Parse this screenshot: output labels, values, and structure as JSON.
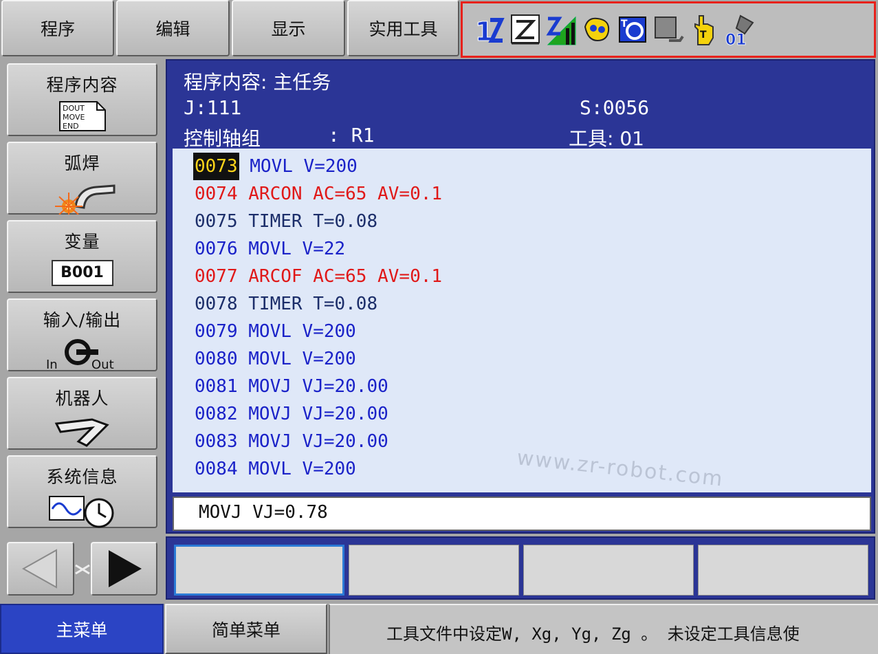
{
  "top_menu": [
    {
      "label": "程序"
    },
    {
      "label": "编辑"
    },
    {
      "label": "显示"
    },
    {
      "label": "实用工具"
    }
  ],
  "status_icons": {
    "tool_number": "01",
    "alert_color": "#e8211b"
  },
  "sidebar": {
    "items": [
      {
        "label": "程序内容",
        "icon_text": [
          "DOUT",
          "MOVE",
          "END"
        ]
      },
      {
        "label": "弧焊"
      },
      {
        "label": "变量",
        "icon_text": "B001"
      },
      {
        "label": "输入/输出",
        "icon_in": "In",
        "icon_out": "Out"
      },
      {
        "label": "机器人"
      },
      {
        "label": "系统信息"
      }
    ]
  },
  "header": {
    "title": "程序内容: 主任务",
    "job": "J:111",
    "step": "S:0056",
    "axis_group_label": "控制轴组",
    "axis_group_value": ": R1",
    "tool": "工具: 01"
  },
  "code_lines": [
    {
      "num": "0073",
      "text": " MOVL V=200",
      "color": "#1a22c8",
      "current": true
    },
    {
      "num": "0074",
      "text": " ARCON AC=65 AV=0.1",
      "color": "#e01818",
      "current": false
    },
    {
      "num": "0075",
      "text": " TIMER T=0.08",
      "color": "#1c2e6a",
      "current": false
    },
    {
      "num": "0076",
      "text": " MOVL V=22",
      "color": "#1a22c8",
      "current": false
    },
    {
      "num": "0077",
      "text": " ARCOF AC=65 AV=0.1",
      "color": "#e01818",
      "current": false
    },
    {
      "num": "0078",
      "text": " TIMER T=0.08",
      "color": "#1c2e6a",
      "current": false
    },
    {
      "num": "0079",
      "text": " MOVL V=200",
      "color": "#1a22c8",
      "current": false
    },
    {
      "num": "0080",
      "text": " MOVL V=200",
      "color": "#1a22c8",
      "current": false
    },
    {
      "num": "0081",
      "text": " MOVJ VJ=20.00",
      "color": "#1a22c8",
      "current": false
    },
    {
      "num": "0082",
      "text": " MOVJ VJ=20.00",
      "color": "#1a22c8",
      "current": false
    },
    {
      "num": "0083",
      "text": " MOVJ VJ=20.00",
      "color": "#1a22c8",
      "current": false
    },
    {
      "num": "0084",
      "text": " MOVL V=200",
      "color": "#1a22c8",
      "current": false
    }
  ],
  "input_line": "MOVJ VJ=0.78",
  "watermark": "www.zr-robot.com",
  "bottom": {
    "main_menu": "主菜单",
    "simple_menu": "简单菜单",
    "message": "工具文件中设定W, Xg, Yg, Zg 。   未设定工具信息使"
  }
}
